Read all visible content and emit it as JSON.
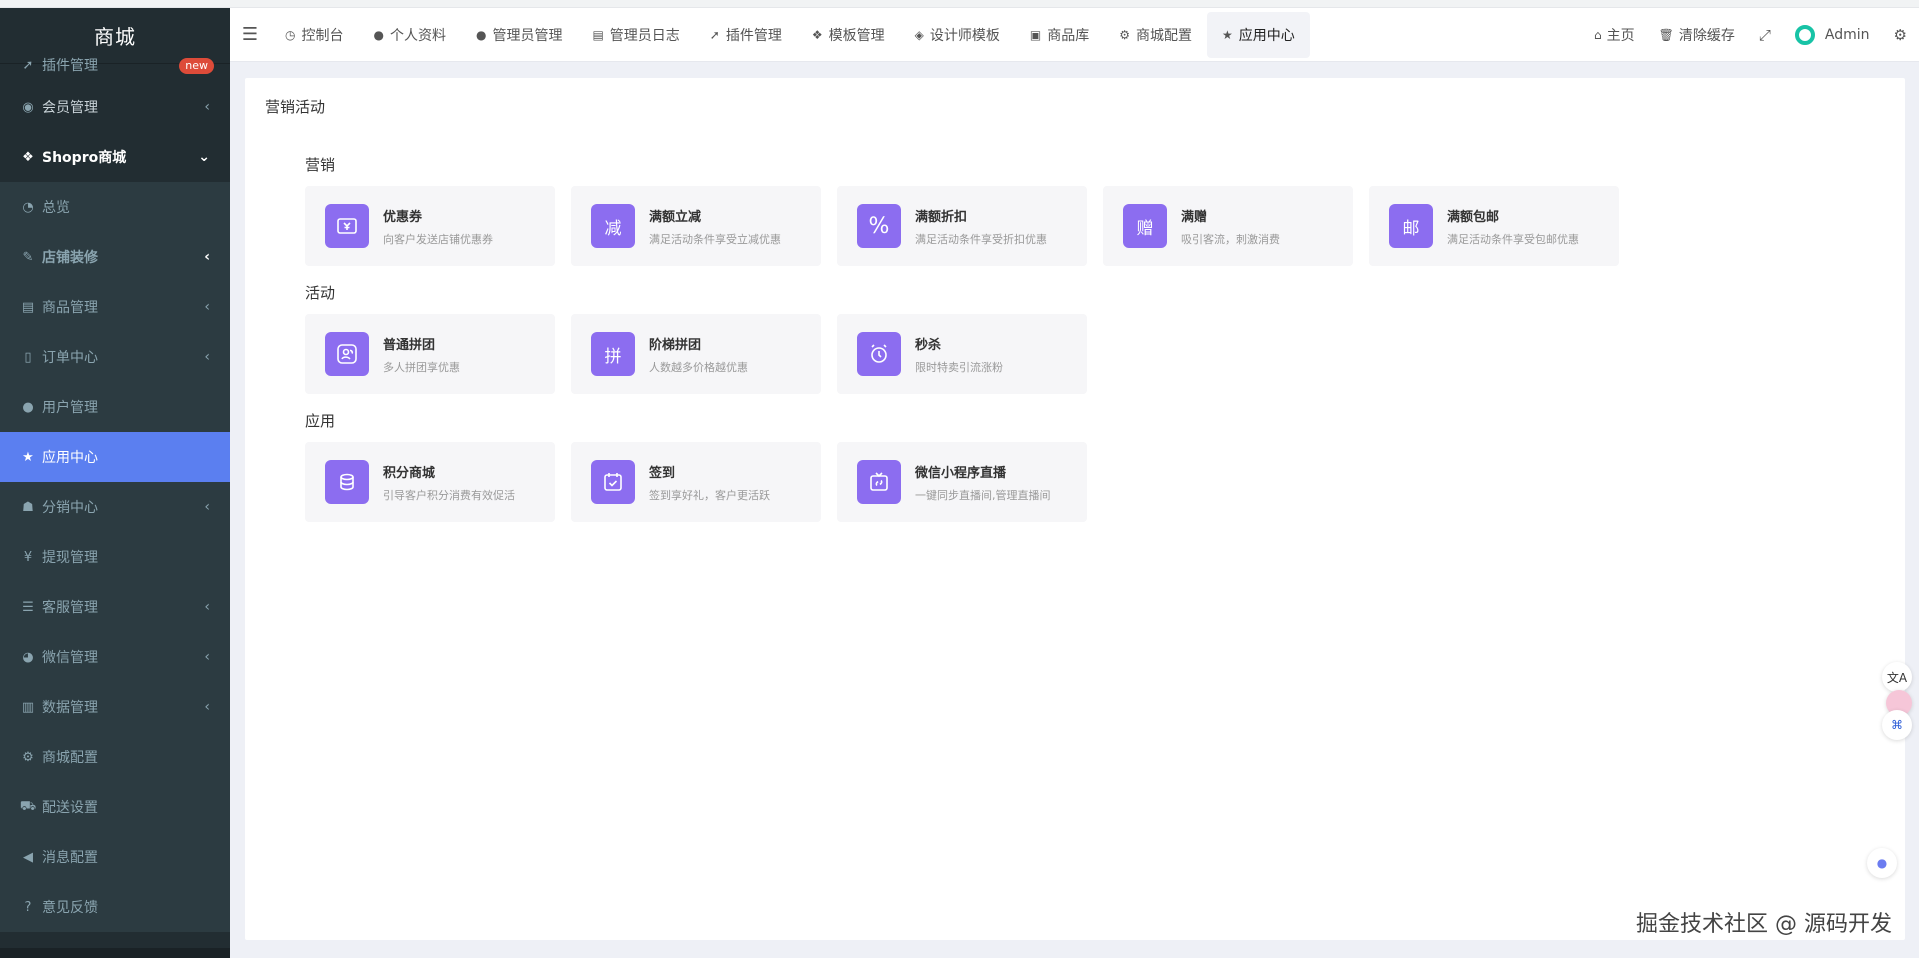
{
  "sidebar": {
    "logo": "商城",
    "items": [
      {
        "label": "插件管理",
        "icon": "rocket-icon",
        "badge": "new"
      },
      {
        "label": "会员管理",
        "icon": "user-circle-icon"
      },
      {
        "label": "Shopro商城",
        "icon": "dropbox-icon"
      },
      {
        "label": "总览",
        "icon": "pie-chart-icon"
      },
      {
        "label": "店铺装修",
        "icon": "paint-brush-icon"
      },
      {
        "label": "商品管理",
        "icon": "archive-icon"
      },
      {
        "label": "订单中心",
        "icon": "file-icon"
      },
      {
        "label": "用户管理",
        "icon": "user-icon"
      },
      {
        "label": "应用中心",
        "icon": "star-icon"
      },
      {
        "label": "分销中心",
        "icon": "users-icon"
      },
      {
        "label": "提现管理",
        "icon": "yen-icon"
      },
      {
        "label": "客服管理",
        "icon": "list-icon"
      },
      {
        "label": "微信管理",
        "icon": "wechat-icon"
      },
      {
        "label": "数据管理",
        "icon": "bar-chart-icon"
      },
      {
        "label": "商城配置",
        "icon": "cogs-icon"
      },
      {
        "label": "配送设置",
        "icon": "car-icon"
      },
      {
        "label": "消息配置",
        "icon": "bullhorn-icon"
      },
      {
        "label": "意见反馈",
        "icon": "question-circle-icon"
      }
    ]
  },
  "topbar": {
    "tabs": [
      {
        "label": "控制台",
        "icon": "dashboard-icon"
      },
      {
        "label": "个人资料",
        "icon": "user-icon"
      },
      {
        "label": "管理员管理",
        "icon": "user-icon"
      },
      {
        "label": "管理员日志",
        "icon": "list-alt-icon"
      },
      {
        "label": "插件管理",
        "icon": "rocket-icon"
      },
      {
        "label": "模板管理",
        "icon": "cubes-icon"
      },
      {
        "label": "设计师模板",
        "icon": "cube-icon"
      },
      {
        "label": "商品库",
        "icon": "shopping-bag-icon"
      },
      {
        "label": "商城配置",
        "icon": "cogs-icon"
      },
      {
        "label": "应用中心",
        "icon": "star-icon"
      }
    ],
    "right": {
      "home": "主页",
      "clear_cache": "清除缓存",
      "user": "Admin"
    }
  },
  "main": {
    "title": "营销活动",
    "sections": [
      {
        "title": "营销",
        "cards": [
          {
            "title": "优惠券",
            "desc": "向客户发送店铺优惠券",
            "icon": "coupon-icon"
          },
          {
            "title": "满额立减",
            "desc": "满足活动条件享受立减优惠",
            "icon": "reduce-icon",
            "glyph": "减"
          },
          {
            "title": "满额折扣",
            "desc": "满足活动条件享受折扣优惠",
            "icon": "percent-icon"
          },
          {
            "title": "满赠",
            "desc": "吸引客流，刺激消费",
            "icon": "gift-icon",
            "glyph": "赠"
          },
          {
            "title": "满额包邮",
            "desc": "满足活动条件享受包邮优惠",
            "icon": "mail-icon",
            "glyph": "邮"
          }
        ]
      },
      {
        "title": "活动",
        "cards": [
          {
            "title": "普通拼团",
            "desc": "多人拼团享优惠",
            "icon": "group-icon"
          },
          {
            "title": "阶梯拼团",
            "desc": "人数越多价格越优惠",
            "icon": "ladder-icon",
            "glyph": "拼"
          },
          {
            "title": "秒杀",
            "desc": "限时特卖引流涨粉",
            "icon": "alarm-icon"
          }
        ]
      },
      {
        "title": "应用",
        "cards": [
          {
            "title": "积分商城",
            "desc": "引导客户积分消费有效促活",
            "icon": "coins-icon"
          },
          {
            "title": "签到",
            "desc": "签到享好礼，客户更活跃",
            "icon": "checkin-icon"
          },
          {
            "title": "微信小程序直播",
            "desc": "一键同步直播间,管理直播间",
            "icon": "live-icon"
          }
        ]
      }
    ]
  },
  "watermark": "掘金技术社区 @ 源码开发"
}
